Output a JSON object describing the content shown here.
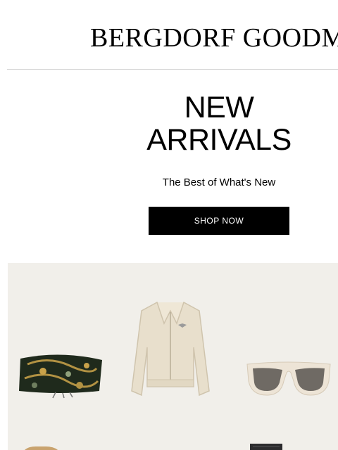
{
  "header": {
    "logo_text": "BERGDORF GOODMAN"
  },
  "hero": {
    "headline_line1": "NEW",
    "headline_line2": "ARRIVALS",
    "tagline": "The Best of What's New",
    "cta_label": "SHOP NOW"
  },
  "products": [
    {
      "name_icon": "beaded-clutch-icon"
    },
    {
      "name_icon": "cropped-jacket-icon"
    },
    {
      "name_icon": "sunglasses-icon"
    },
    {
      "name_icon": "tan-item-icon"
    },
    {
      "name_icon": "denim-item-icon"
    }
  ],
  "colors": {
    "accent": "#000000",
    "grid_bg": "#f1efea"
  }
}
